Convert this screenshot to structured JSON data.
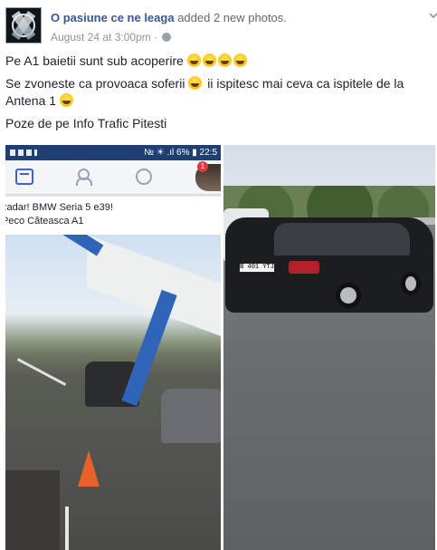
{
  "post": {
    "page_name": "O pasiune ce ne leaga",
    "action_text": "added 2 new photos.",
    "timestamp": "August 24 at 3:00pm",
    "separator": "·",
    "lines": [
      "Pe A1 baietii sunt sub acoperire",
      "Se zvoneste ca provoaca soferii",
      "ii ispitesc mai ceva ca ispitele de la Antena 1",
      "Poze de pe Info Trafic Pitesti"
    ]
  },
  "photo_left": {
    "status_right": "№ ☀ .ıl 6% ▮ 22:5",
    "badge_count": "1",
    "caption_line1": "zadar! BMW Seria 5 e39!",
    "caption_line2": "Peco Căteasca A1"
  },
  "photo_right": {
    "plate_text": "B 401 YTJ"
  },
  "colors": {
    "link": "#365899",
    "meta": "#90949c",
    "fb_blue": "#1f3f73"
  },
  "icons": [
    "globe-icon",
    "chevron-down-icon",
    "news-feed-icon",
    "friends-icon",
    "notifications-globe-icon",
    "laughing-emoji-icon",
    "smiling-emoji-icon"
  ]
}
